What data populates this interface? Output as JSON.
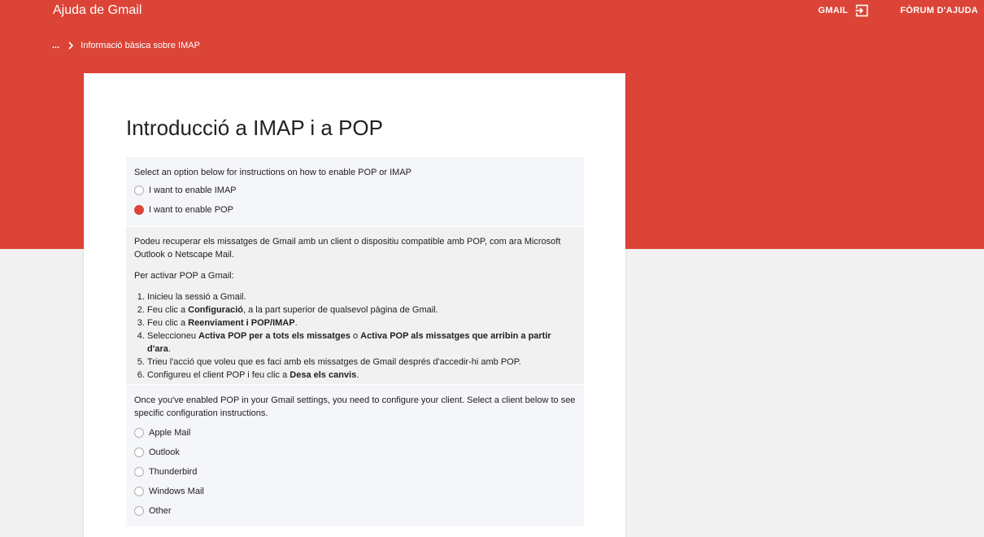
{
  "header": {
    "app_title": "Ajuda de Gmail",
    "gmail_label": "GMAIL",
    "forum_label": "FÒRUM D'AJUDA",
    "accent_color": "#db4437"
  },
  "breadcrumb": {
    "ellipsis": "...",
    "current": "Informació bàsica sobre IMAP"
  },
  "article": {
    "title": "Introducció a IMAP i a POP",
    "select": {
      "prompt": "Select an option below for instructions on how to enable POP or IMAP",
      "options": [
        {
          "label": "I want to enable IMAP",
          "checked": false
        },
        {
          "label": "I want to enable POP",
          "checked": true
        }
      ]
    },
    "pop": {
      "intro": "Podeu recuperar els missatges de Gmail amb un client o dispositiu compatible amb POP, com ara Microsoft Outlook o Netscape Mail.",
      "activate": "Per activar POP a Gmail:",
      "steps": [
        {
          "a": "Inicieu la sessió a Gmail.",
          "b1": "",
          "c": "",
          "b2": "",
          "d": ""
        },
        {
          "a": "Feu clic a ",
          "b1": "Configuració",
          "c": ", a la part superior de qualsevol pàgina de Gmail.",
          "b2": "",
          "d": ""
        },
        {
          "a": "Feu clic a ",
          "b1": "Reenviament i POP/IMAP",
          "c": ".",
          "b2": "",
          "d": ""
        },
        {
          "a": "Seleccioneu ",
          "b1": "Activa POP per a tots els missatges",
          "c": " o ",
          "b2": "Activa POP als missatges que arribin a partir d'ara",
          "d": "."
        },
        {
          "a": "Trieu l'acció que voleu que es faci amb els missatges de Gmail després d'accedir-hi amb POP.",
          "b1": "",
          "c": "",
          "b2": "",
          "d": ""
        },
        {
          "a": "Configureu el client POP i feu clic a ",
          "b1": "Desa els canvis",
          "c": ".",
          "b2": "",
          "d": ""
        }
      ]
    },
    "client": {
      "prompt": "Once you've enabled POP in your Gmail settings, you need to configure your client. Select a client below to see specific configuration instructions.",
      "options": [
        {
          "label": "Apple Mail",
          "checked": false
        },
        {
          "label": "Outlook",
          "checked": false
        },
        {
          "label": "Thunderbird",
          "checked": false
        },
        {
          "label": "Windows Mail",
          "checked": false
        },
        {
          "label": "Other",
          "checked": false
        }
      ]
    }
  }
}
